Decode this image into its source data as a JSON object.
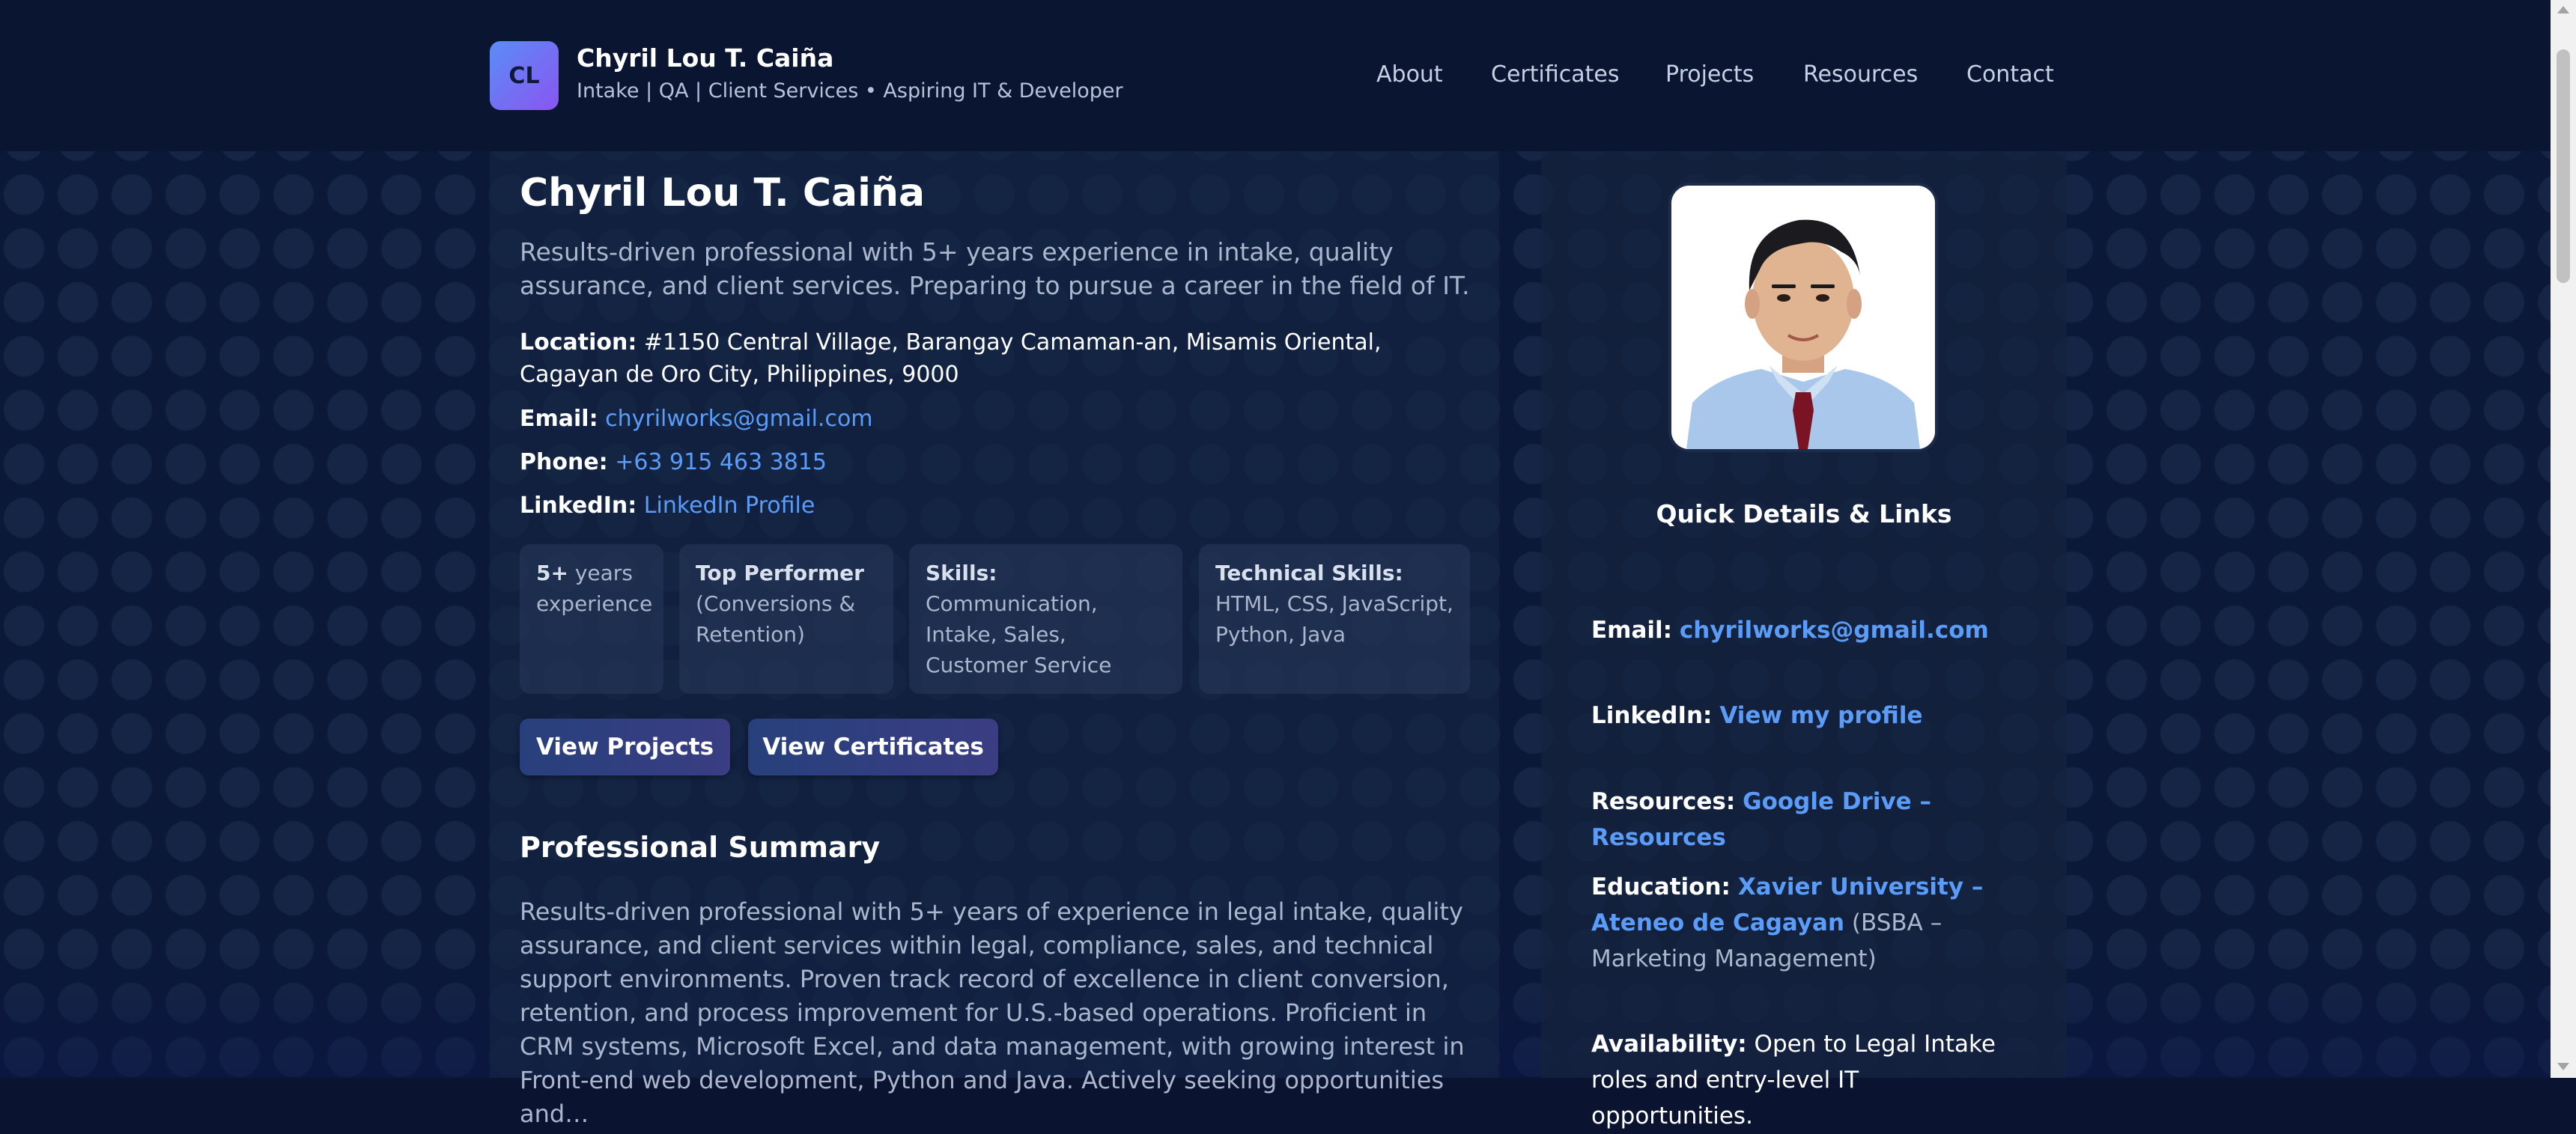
{
  "header": {
    "logo_initials": "CL",
    "name": "Chyril Lou T. Caiña",
    "tagline": "Intake | QA | Client Services • Aspiring IT & Developer",
    "nav": [
      "About",
      "Certificates",
      "Projects",
      "Resources",
      "Contact"
    ]
  },
  "hero": {
    "name": "Chyril Lou T. Caiña",
    "lead": "Results-driven professional with 5+ years experience in intake, quality assurance, and client services. Preparing to pursue a career in the field of IT.",
    "location_label": "Location:",
    "location_value": "#1150 Central Village, Barangay Camaman-an, Misamis Oriental, Cagayan de Oro City, Philippines, 9000",
    "email_label": "Email:",
    "email_value": "chyrilworks@gmail.com",
    "phone_label": "Phone:",
    "phone_value": "+63 915 463 3815",
    "linkedin_label": "LinkedIn:",
    "linkedin_value": "LinkedIn Profile"
  },
  "stats": [
    {
      "bold": "5+",
      "text": " years experience"
    },
    {
      "bold": "Top Performer",
      "text": " (Conversions & Retention)"
    },
    {
      "bold": "Skills:",
      "text": " Communication, Intake, Sales, Customer Service"
    },
    {
      "bold": "Technical Skills:",
      "text": " HTML, CSS, JavaScript, Python, Java"
    }
  ],
  "buttons": {
    "view_projects": "View Projects",
    "view_certificates": "View Certificates"
  },
  "summary": {
    "title": "Professional Summary",
    "text": "Results-driven professional with 5+ years of experience in legal intake, quality assurance, and client services within legal, compliance, sales, and technical support environments. Proven track record of excellence in client conversion, retention, and process improvement for U.S.-based operations. Proficient in CRM systems, Microsoft Excel, and data management, with growing interest in Front-end web development, Python and Java. Actively seeking opportunities and…"
  },
  "sidebar": {
    "quick_title": "Quick Details & Links",
    "email_label": "Email:",
    "email_value": "chyrilworks@gmail.com",
    "linkedin_label": "LinkedIn:",
    "linkedin_value": "View my profile",
    "resources_label": "Resources:",
    "resources_value": "Google Drive – Resources",
    "education_label": "Education:",
    "education_value": "Xavier University – Ateneo de Cagayan",
    "education_note": "(BSBA – Marketing Management)",
    "availability_label": "Availability:",
    "availability_value": "Open to Legal Intake roles and entry-level IT opportunities."
  },
  "colors": {
    "background": "#0b1838",
    "link": "#5a9cf7",
    "logo_gradient_start": "#5b8df6",
    "logo_gradient_end": "#8a55f1",
    "button": "#27407c"
  },
  "icons": {
    "profile_photo": "profile-photo"
  }
}
